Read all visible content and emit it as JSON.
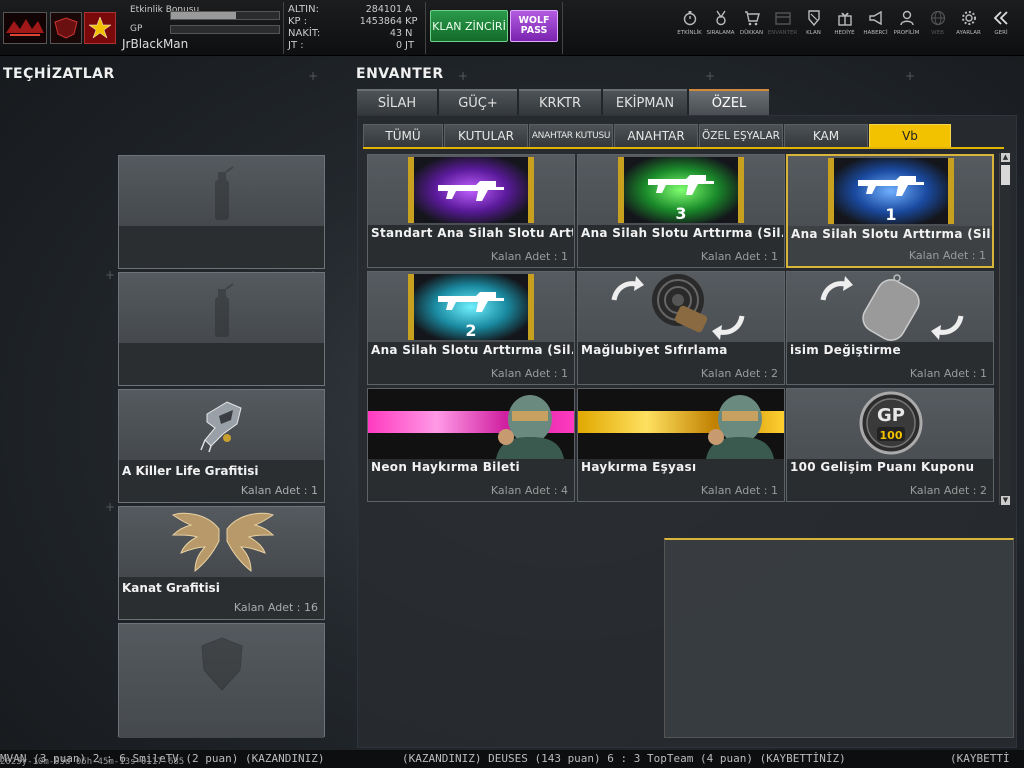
{
  "user": {
    "name": "JrBlackMan",
    "event_bonus_label": "Etkinlik Bonusu",
    "event_bonus_progress": 0.6,
    "gp_label": "GP",
    "gp_progress": 0.0
  },
  "currency": [
    {
      "label": "ALTIN:",
      "value": "284101",
      "unit": "A"
    },
    {
      "label": "KP   :",
      "value": "1453864",
      "unit": "KP"
    },
    {
      "label": "NAKİT:",
      "value": "43",
      "unit": "N"
    },
    {
      "label": "JT   :",
      "value": "0",
      "unit": "JT"
    }
  ],
  "buttons": {
    "klan_zinciri": "KLAN ZİNCİRİ",
    "wolf_pass": "WOLF PASS"
  },
  "nav": [
    {
      "label": "ETKİNLİK",
      "icon": "stopwatch-icon",
      "enabled": true
    },
    {
      "label": "SIRALAMA",
      "icon": "medal-icon",
      "enabled": true
    },
    {
      "label": "DÜKKAN",
      "icon": "cart-icon",
      "enabled": true
    },
    {
      "label": "ENVANTER",
      "icon": "inventory-icon",
      "enabled": false
    },
    {
      "label": "KLAN",
      "icon": "clan-shield-icon",
      "enabled": true
    },
    {
      "label": "HEDİYE",
      "icon": "gift-icon",
      "enabled": true
    },
    {
      "label": "HABERCİ",
      "icon": "megaphone-icon",
      "enabled": true
    },
    {
      "label": "PROFİLİM",
      "icon": "profile-icon",
      "enabled": true
    },
    {
      "label": "WEB",
      "icon": "globe-icon",
      "enabled": false
    },
    {
      "label": "AYARLAR",
      "icon": "gear-icon",
      "enabled": true
    },
    {
      "label": "GERİ",
      "icon": "back-icon",
      "enabled": true
    }
  ],
  "equipment": {
    "title": "TEÇHİZATLAR",
    "slots": [
      {
        "name": "",
        "count": "",
        "icon": "spray-can-icon"
      },
      {
        "name": "",
        "count": "",
        "icon": "spray-can-icon"
      },
      {
        "name": "A Killer Life Grafitisi",
        "count": "Kalan Adet : 1",
        "icon": "killer-graffiti-icon"
      },
      {
        "name": "Kanat Grafitisi",
        "count": "Kalan Adet : 16",
        "icon": "wings-icon"
      },
      {
        "name": "",
        "count": "",
        "icon": "shield-icon"
      }
    ]
  },
  "inventory": {
    "title": "ENVANTER",
    "main_tabs": [
      {
        "label": "SİLAH",
        "active": false
      },
      {
        "label": "GÜÇ+",
        "active": false
      },
      {
        "label": "KRKTR",
        "active": false
      },
      {
        "label": "EKİPMAN",
        "active": false
      },
      {
        "label": "ÖZEL",
        "active": true
      }
    ],
    "sub_tabs": [
      {
        "label": "TÜMÜ",
        "active": false
      },
      {
        "label": "KUTULAR",
        "active": false
      },
      {
        "label": "ANAHTAR KUTUSU",
        "active": false
      },
      {
        "label": "ANAHTAR",
        "active": false
      },
      {
        "label": "ÖZEL EŞYALAR",
        "active": false
      },
      {
        "label": "KAM",
        "active": false
      },
      {
        "label": "Vb",
        "active": true
      }
    ],
    "items": [
      {
        "name": "Standart Ana Silah Slotu Artt...",
        "count": "Kalan Adet : 1",
        "icon": "rifle-slot-purple-icon",
        "badge": ""
      },
      {
        "name": "Ana Silah Slotu Arttırma (Sil...",
        "count": "Kalan Adet : 1",
        "icon": "rifle-slot-green-icon",
        "badge": "3"
      },
      {
        "name": "Ana Silah Slotu Arttırma (Sil...",
        "count": "Kalan Adet : 1",
        "icon": "rifle-slot-blue-icon",
        "badge": "1"
      },
      {
        "name": "Ana Silah Slotu Arttırma (Sil...",
        "count": "Kalan Adet : 1",
        "icon": "rifle-slot-cyan-icon",
        "badge": "2"
      },
      {
        "name": "Mağlubiyet  Sıfırlama",
        "count": "Kalan Adet : 2",
        "icon": "reset-loss-icon",
        "badge": ""
      },
      {
        "name": "isim Değiştirme",
        "count": "Kalan Adet : 1",
        "icon": "dogtag-icon",
        "badge": ""
      },
      {
        "name": "Neon Haykırma Bileti",
        "count": "Kalan Adet : 4",
        "icon": "neon-shout-icon",
        "badge": ""
      },
      {
        "name": "Haykırma Eşyası",
        "count": "Kalan Adet : 1",
        "icon": "shout-item-icon",
        "badge": ""
      },
      {
        "name": "100 Gelişim Puanı Kuponu",
        "count": "Kalan Adet : 2",
        "icon": "gp-coupon-icon",
        "badge": "100"
      }
    ],
    "gp_badge_label": "GP"
  },
  "ticker": {
    "text1": "MVAN (3 puan) 2 : 6 SmileTV (2 puan) (KAZANDINIZ)",
    "text2": "(KAZANDINIZ) DEUSES (143 puan) 6 : 3 TopTeam (4 puan) (KAYBETTİNİZ)",
    "text3": "(KAYBETTİ"
  },
  "status_line": "2025y-10m-05d 06h-45m-13s-0117-685"
}
